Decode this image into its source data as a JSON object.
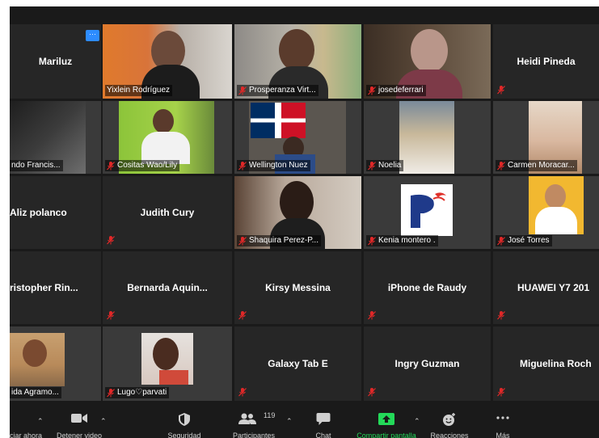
{
  "participants": [
    {
      "name": "Mariluz"
    },
    {
      "name": "Yixlein Rodríguez"
    },
    {
      "name": "Prosperanza Virt..."
    },
    {
      "name": "josedeferrari"
    },
    {
      "name": "Heidi Pineda"
    },
    {
      "name": "ndo Francis..."
    },
    {
      "name": "Cositas Wao/Lily"
    },
    {
      "name": "Wellington Nuez"
    },
    {
      "name": "Noelia"
    },
    {
      "name": "Carmen Moracar..."
    },
    {
      "name": "Aliz polanco"
    },
    {
      "name": "Judith Cury"
    },
    {
      "name": "Shaquira Perez-P..."
    },
    {
      "name": "Kenia montero ."
    },
    {
      "name": "José Torres"
    },
    {
      "name": "ristopher  Rin..."
    },
    {
      "name": "Bernarda  Aquin..."
    },
    {
      "name": "Kirsy Messina"
    },
    {
      "name": "iPhone de Raudy"
    },
    {
      "name": "HUAWEI Y7 201"
    },
    {
      "name": "ida Agramo..."
    },
    {
      "name": "Lugo♡parvati"
    },
    {
      "name": "Galaxy Tab E"
    },
    {
      "name": "Ingry Guzman"
    },
    {
      "name": "Miguelina Roch"
    }
  ],
  "more_button": "···",
  "toolbar": {
    "audio_label": "ciar ahora",
    "video_label": "Detener video",
    "security_label": "Seguridad",
    "participants_label": "Participantes",
    "participants_count": "119",
    "chat_label": "Chat",
    "share_label": "Compartir pantalla",
    "reactions_label": "Reacciones",
    "more_label": "Más"
  },
  "colors": {
    "active_border": "#c4e34a",
    "share_green": "#23d959",
    "more_blue": "#2d8cff",
    "mute_red": "#e02828"
  }
}
